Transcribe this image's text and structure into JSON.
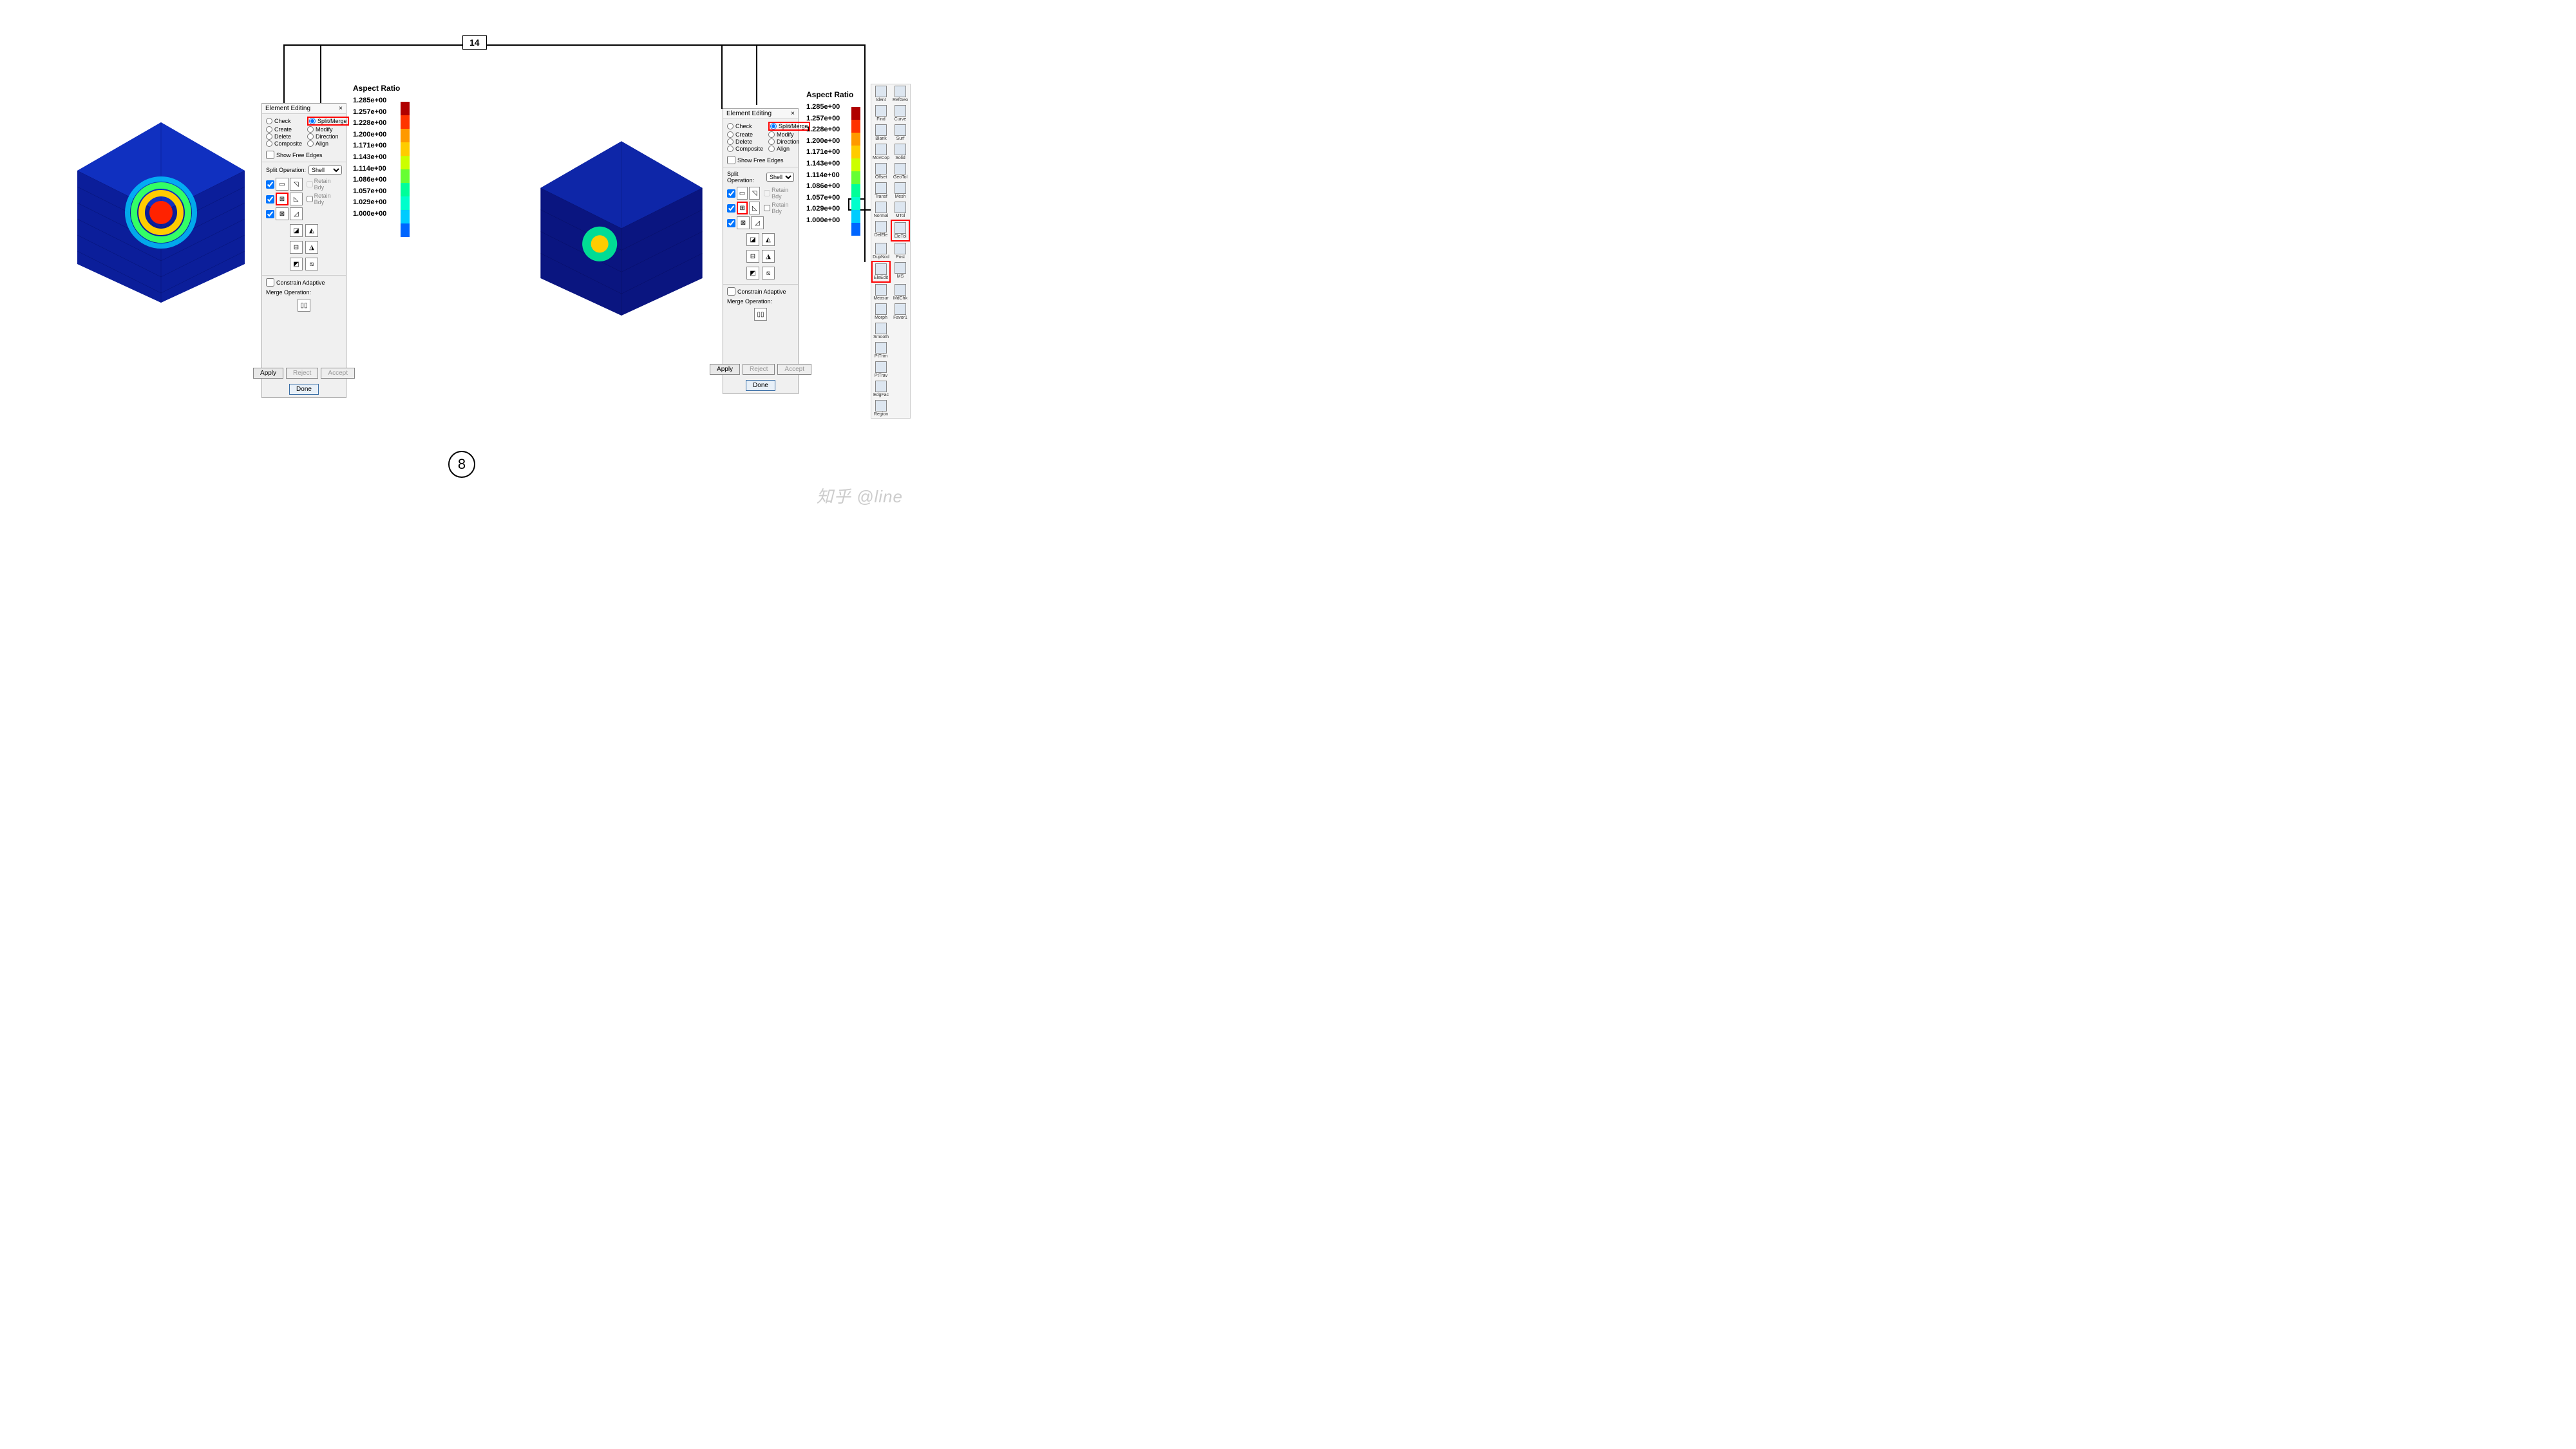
{
  "callout": {
    "label": "14"
  },
  "step": {
    "label": "8"
  },
  "watermark": "知乎 @line",
  "legend": {
    "title": "Aspect Ratio",
    "values": [
      "1.285e+00",
      "1.257e+00",
      "1.228e+00",
      "1.200e+00",
      "1.171e+00",
      "1.143e+00",
      "1.114e+00",
      "1.086e+00",
      "1.057e+00",
      "1.029e+00",
      "1.000e+00"
    ],
    "colors": [
      "#b00000",
      "#ff3300",
      "#ff9900",
      "#ffcc00",
      "#ccff00",
      "#66ff33",
      "#00ff99",
      "#00ffcc",
      "#00ccff",
      "#0066ff"
    ]
  },
  "panel": {
    "title": "Element Editing",
    "close": "×",
    "radios": {
      "check": "Check",
      "splitmerge": "Split/Merge",
      "create": "Create",
      "modify": "Modify",
      "delete": "Delete",
      "direction": "Direction",
      "composite": "Composite",
      "align": "Align"
    },
    "show_free_edges": "Show Free Edges",
    "split_op_label": "Split Operation:",
    "split_op_value": "Shell",
    "retain_bdy": "Retain Bdy",
    "constrain_adaptive": "Constrain Adaptive",
    "merge_op_label": "Merge Operation:",
    "apply": "Apply",
    "reject": "Reject",
    "accept": "Accept",
    "done": "Done"
  },
  "toolbox": {
    "items": [
      {
        "l": "Ident"
      },
      {
        "l": "RefGeo"
      },
      {
        "l": "Find"
      },
      {
        "l": "Curve"
      },
      {
        "l": "Blank"
      },
      {
        "l": "Surf"
      },
      {
        "l": "MovCop"
      },
      {
        "l": "Solid"
      },
      {
        "l": "Offset"
      },
      {
        "l": "GeoTol"
      },
      {
        "l": "Transf"
      },
      {
        "l": "Mesh"
      },
      {
        "l": "Normal"
      },
      {
        "l": "MTol"
      },
      {
        "l": "DelEle"
      },
      {
        "l": "EleTol",
        "sel": true
      },
      {
        "l": "DupNod"
      },
      {
        "l": "Post"
      },
      {
        "l": "EleEdit",
        "sel": true
      },
      {
        "l": "MS"
      },
      {
        "l": "Measur"
      },
      {
        "l": "MdChk"
      },
      {
        "l": "Morph"
      },
      {
        "l": "Favor1"
      },
      {
        "l": "Smooth"
      },
      {
        "l": ""
      },
      {
        "l": "PtTrim"
      },
      {
        "l": ""
      },
      {
        "l": "PtTrav"
      },
      {
        "l": ""
      },
      {
        "l": "EdgFac"
      },
      {
        "l": ""
      },
      {
        "l": "Region"
      },
      {
        "l": ""
      }
    ]
  }
}
